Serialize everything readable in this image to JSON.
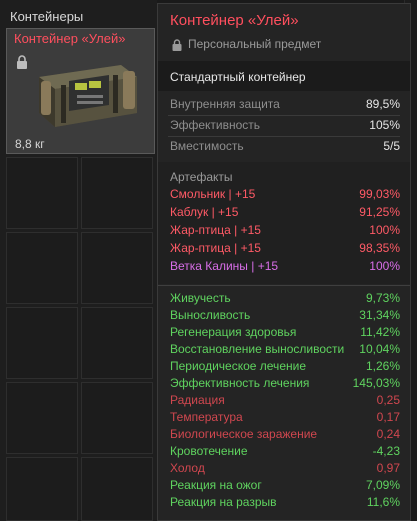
{
  "inventory": {
    "title": "Контейнеры",
    "slot": {
      "name": "Контейнер «Улей»",
      "weight": "8,8 кг"
    }
  },
  "tooltip": {
    "title": "Контейнер «Улей»",
    "subtitle": "Персональный предмет",
    "type": "Стандартный контейнер",
    "base_stats": [
      {
        "label": "Внутренняя защита",
        "value": "89,5%"
      },
      {
        "label": "Эффективность",
        "value": "105%"
      },
      {
        "label": "Вместимость",
        "value": "5/5"
      }
    ],
    "artifacts_label": "Артефакты",
    "artifacts": [
      {
        "label": "Смольник | +15",
        "value": "99,03%",
        "color": "#ff5a66"
      },
      {
        "label": "Каблук | +15",
        "value": "91,25%",
        "color": "#ff5a66"
      },
      {
        "label": "Жар-птица | +15",
        "value": "100%",
        "color": "#ff5a66"
      },
      {
        "label": "Жар-птица | +15",
        "value": "98,35%",
        "color": "#ff5a66"
      },
      {
        "label": "Ветка Калины | +15",
        "value": "100%",
        "color": "#d86ee8"
      }
    ],
    "effects": [
      {
        "label": "Живучесть",
        "value": "9,73%",
        "color": "#5fd35f"
      },
      {
        "label": "Выносливость",
        "value": "31,34%",
        "color": "#5fd35f"
      },
      {
        "label": "Регенерация здоровья",
        "value": "11,42%",
        "color": "#5fd35f"
      },
      {
        "label": "Восстановление выносливости",
        "value": "10,04%",
        "color": "#5fd35f"
      },
      {
        "label": "Периодическое лечение",
        "value": "1,26%",
        "color": "#5fd35f"
      },
      {
        "label": "Эффективность лечения",
        "value": "145,03%",
        "color": "#5fd35f"
      },
      {
        "label": "Радиация",
        "value": "0,25",
        "color": "#d0474f"
      },
      {
        "label": "Температура",
        "value": "0,17",
        "color": "#d0474f"
      },
      {
        "label": "Биологическое заражение",
        "value": "0,24",
        "color": "#d0474f"
      },
      {
        "label": "Кровотечение",
        "value": "-4,23",
        "color": "#5fd35f"
      },
      {
        "label": "Холод",
        "value": "0,97",
        "color": "#d0474f"
      },
      {
        "label": "Реакция на ожог",
        "value": "7,09%",
        "color": "#5fd35f"
      },
      {
        "label": "Реакция на разрыв",
        "value": "11,6%",
        "color": "#5fd35f"
      }
    ]
  },
  "colors": {
    "accent_red": "#ff4f5e",
    "stat_label": "#8e8e8e",
    "stat_value": "#e6e6e6"
  }
}
